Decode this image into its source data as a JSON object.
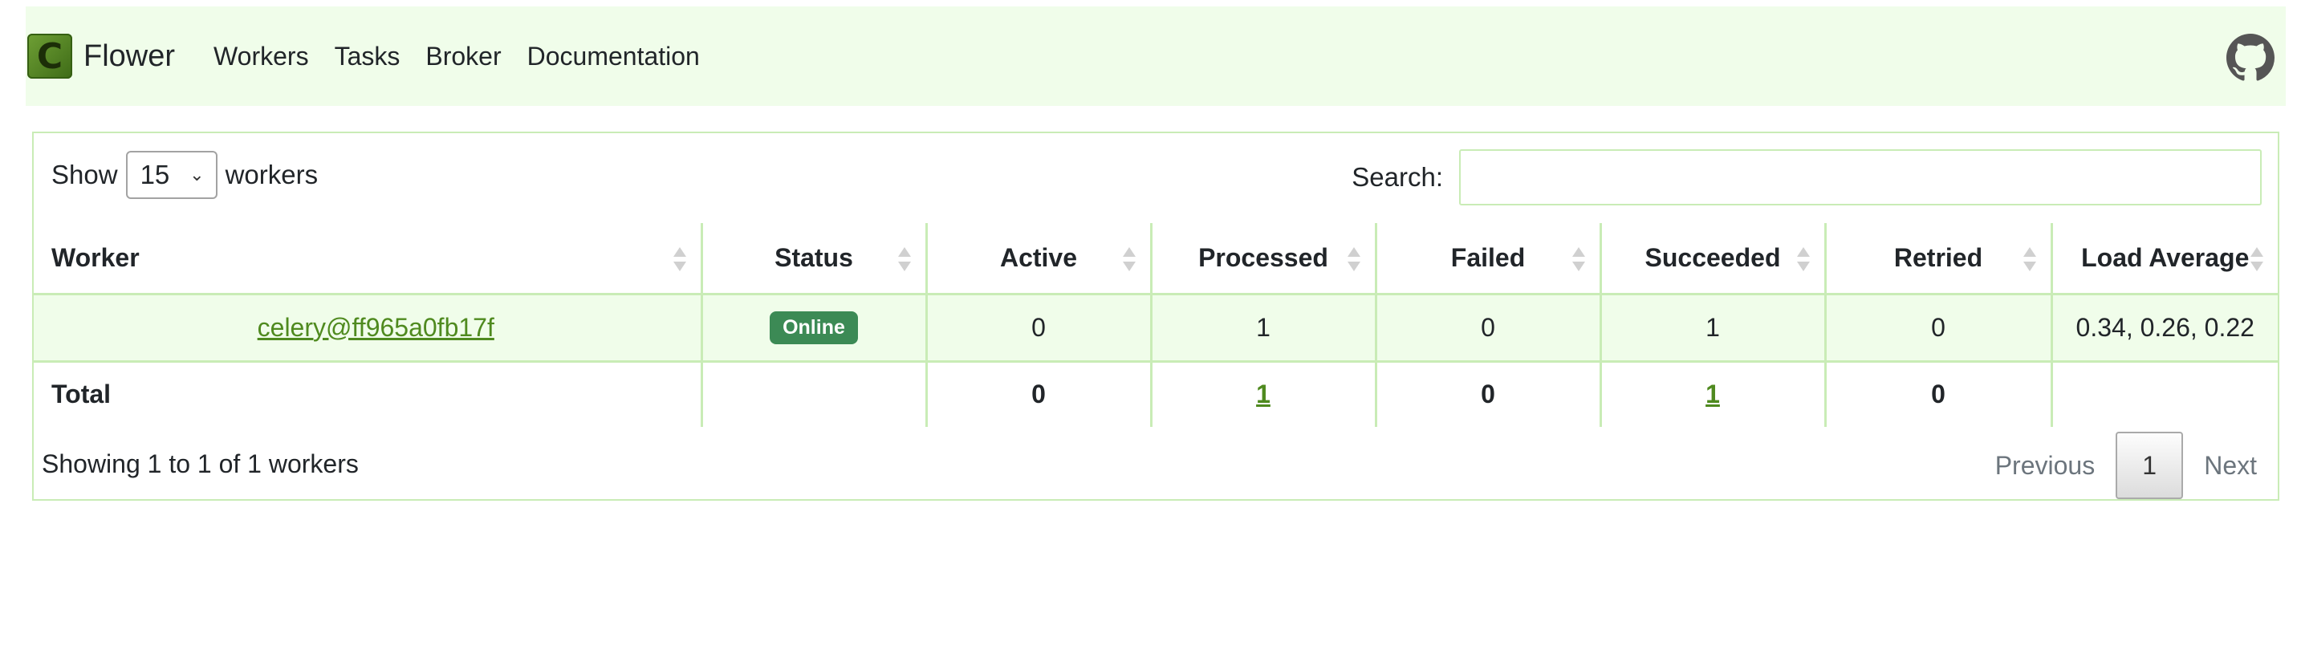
{
  "navbar": {
    "brand_letter": "C",
    "brand_name": "Flower",
    "links": [
      "Workers",
      "Tasks",
      "Broker",
      "Documentation"
    ],
    "github_icon": "github-icon"
  },
  "controls": {
    "show_label": "Show",
    "page_size": "15",
    "workers_label": "workers",
    "search_label": "Search:",
    "search_value": ""
  },
  "table": {
    "headers": [
      "Worker",
      "Status",
      "Active",
      "Processed",
      "Failed",
      "Succeeded",
      "Retried",
      "Load Average"
    ],
    "rows": [
      {
        "worker": "celery@ff965a0fb17f",
        "status": "Online",
        "active": "0",
        "processed": "1",
        "failed": "0",
        "succeeded": "1",
        "retried": "0",
        "load_average": "0.34, 0.26, 0.22"
      }
    ],
    "total": {
      "label": "Total",
      "active": "0",
      "processed": "1",
      "failed": "0",
      "succeeded": "1",
      "retried": "0",
      "load_average": ""
    }
  },
  "footer": {
    "info": "Showing 1 to 1 of 1 workers",
    "previous": "Previous",
    "current_page": "1",
    "next": "Next"
  },
  "colors": {
    "navbar_bg": "#f0fdea",
    "border": "#c9ecb6",
    "link": "#4f8a1f",
    "online_badge": "#3c8a55"
  }
}
